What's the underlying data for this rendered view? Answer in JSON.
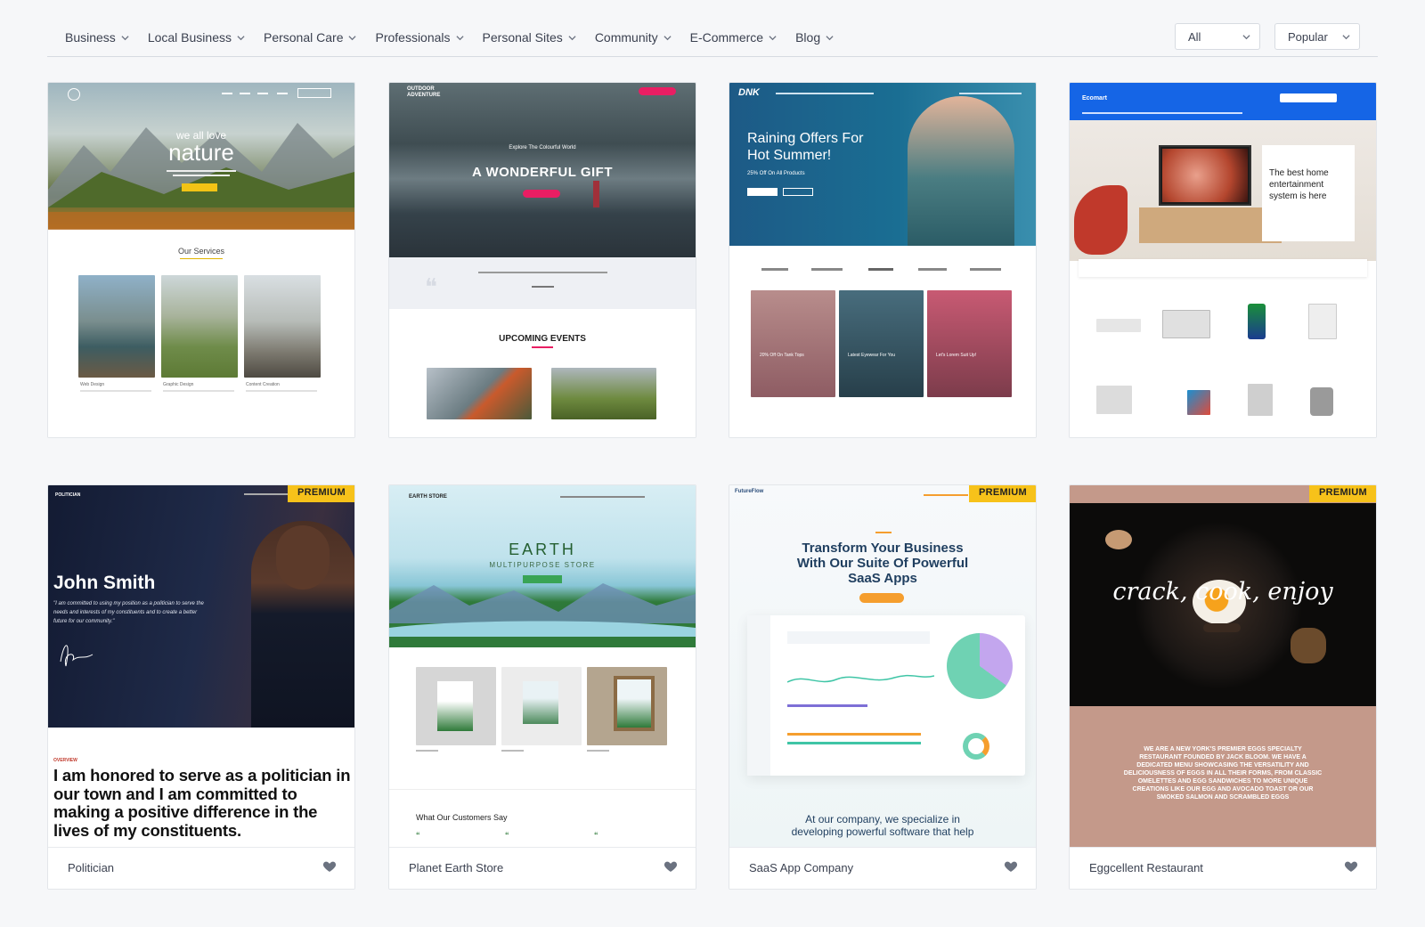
{
  "filters": {
    "categories": [
      {
        "label": "Business"
      },
      {
        "label": "Local Business"
      },
      {
        "label": "Personal Care"
      },
      {
        "label": "Professionals"
      },
      {
        "label": "Personal Sites"
      },
      {
        "label": "Community"
      },
      {
        "label": "E-Commerce"
      },
      {
        "label": "Blog"
      }
    ],
    "type_select": "All",
    "sort_select": "Popular"
  },
  "badge_label": "PREMIUM",
  "cards": [
    {
      "premium": false,
      "preview": {
        "hero_small": "we all love",
        "hero_big": "nature",
        "section": "Our Services",
        "items": [
          "Web Design",
          "Graphic Design",
          "Content Creation"
        ]
      }
    },
    {
      "premium": false,
      "preview": {
        "brand": "OUTDOOR ADVENTURE",
        "kicker": "Explore The Colourful World",
        "hero": "A WONDERFUL GIFT",
        "section": "UPCOMING EVENTS"
      }
    },
    {
      "premium": false,
      "preview": {
        "brand": "DNK",
        "hero_line1": "Raining Offers For",
        "hero_line2": "Hot Summer!",
        "sub": "25% Off On All Products",
        "tiles": [
          "20% Off On Tank Tops",
          "Latest Eyewear For You",
          "Let's Lorem Suit Up!"
        ]
      }
    },
    {
      "premium": true,
      "preview": {
        "brand": "Ecomart",
        "hero_line1": "The best home",
        "hero_line2": "entertainment",
        "hero_line3": "system is here"
      }
    },
    {
      "premium": true,
      "name": "Politician",
      "preview": {
        "brand": "POLITICIAN",
        "person": "John Smith",
        "quote": "\"I am committed to using my position as a politician to serve the needs and interests of my constituents and to create a better future for our community.\"",
        "overline": "OVERVIEW",
        "statement": "I am honored to serve as a politician in our town and I am committed to making a positive difference in the lives of my constituents."
      }
    },
    {
      "premium": false,
      "name": "Planet Earth Store",
      "preview": {
        "brand": "EARTH STORE",
        "hero": "EARTH",
        "sub": "MULTIPURPOSE STORE",
        "testimonials": "What Our Customers Say"
      }
    },
    {
      "premium": true,
      "name": "SaaS App Company",
      "preview": {
        "brand": "FutureFlow",
        "hero_line1": "Transform Your Business",
        "hero_line2": "With Our Suite Of Powerful",
        "hero_line3": "SaaS Apps",
        "bottom_line1": "At our company, we specialize in",
        "bottom_line2": "developing powerful software that help"
      }
    },
    {
      "premium": true,
      "name": "Eggcellent Restaurant",
      "preview": {
        "hero": "crack, cook, enjoy",
        "about": "WE ARE A NEW YORK'S PREMIER EGGS SPECIALTY RESTAURANT FOUNDED BY JACK BLOOM. WE HAVE A DEDICATED MENU SHOWCASING THE VERSATILITY AND DELICIOUSNESS OF EGGS IN ALL THEIR FORMS, FROM CLASSIC OMELETTES AND EGG SANDWICHES TO MORE UNIQUE CREATIONS LIKE OUR EGG AND AVOCADO TOAST OR OUR SMOKED SALMON AND SCRAMBLED EGGS"
      }
    }
  ],
  "colors": {
    "badge": "#f7c21a",
    "background": "#f6f7f9",
    "heart": "#6b7280"
  },
  "icons": {
    "dropdown": "chevron-down-icon",
    "favorite": "heart-icon"
  }
}
